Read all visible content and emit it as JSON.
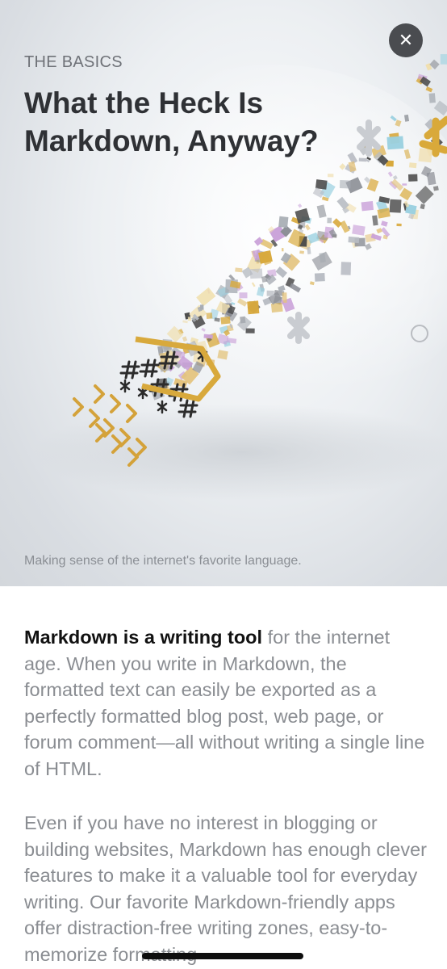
{
  "hero": {
    "eyebrow": "THE BASICS",
    "title": "What the Heck Is Markdown, Anyway?",
    "caption": "Making sense of the internet's favorite language.",
    "close_icon": "close-icon"
  },
  "article": {
    "p1_lead": "Markdown is a writing tool",
    "p1_rest": " for the internet age. When you write in Markdown, the formatted text can easily be exported as a perfectly formatted blog post, web page, or forum comment—all without writing a single line of HTML.",
    "p2": "Even if you have no interest in blogging or building websites, Markdown has enough clever features to make it a valuable tool for everyday writing. Our favorite Markdown-friendly apps offer distraction-free writing zones, easy-to-memorize formatting"
  },
  "colors": {
    "title": "#2f3135",
    "body_text": "#8a8d92",
    "lead_text": "#111111",
    "close_button": "#4a4c50"
  }
}
